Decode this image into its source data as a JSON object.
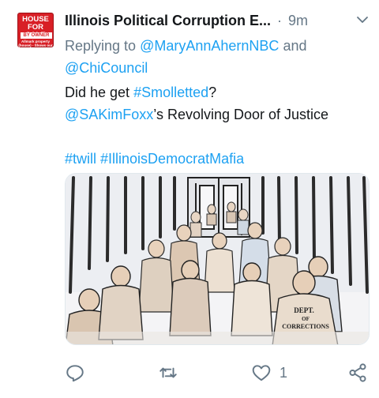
{
  "tweet": {
    "author_name": "Illinois Political Corruption E...",
    "separator": "·",
    "time": "9m",
    "reply_prefix": "Replying to",
    "reply_to_1": "@MaryAnnAhernNBC",
    "reply_and": "and",
    "reply_to_2": "@ChiCouncil",
    "line1_text": "Did he get ",
    "line1_hashtag": "#Smolletted",
    "line1_end": "?",
    "line2_mention": "@SAKimFoxx",
    "line2_text": "’s Revolving Door of Justice",
    "hashtag_1": "#twill",
    "hashtag_2": "#IllinoisDemocratMafia"
  },
  "avatar": {
    "sign_line1": "HOUSE",
    "sign_line2": "FOR SALE",
    "sign_line3": "BY OWNER",
    "sign_line4": "Allmark property (house) - Shows our own"
  },
  "media": {
    "jacket_text_1": "DEPT.",
    "jacket_text_2": "OF",
    "jacket_text_3": "CORRECTIONS"
  },
  "actions": {
    "reply_count": "",
    "retweet_count": "",
    "like_count": "1"
  },
  "icons": {
    "chevron": "chevron-down-icon",
    "reply": "reply-icon",
    "retweet": "retweet-icon",
    "like": "heart-icon",
    "share": "share-icon"
  },
  "colors": {
    "link": "#1da1f2",
    "secondary_text": "#657786",
    "primary_text": "#14171a",
    "icon": "#657786",
    "avatar_red": "#d81f26"
  }
}
